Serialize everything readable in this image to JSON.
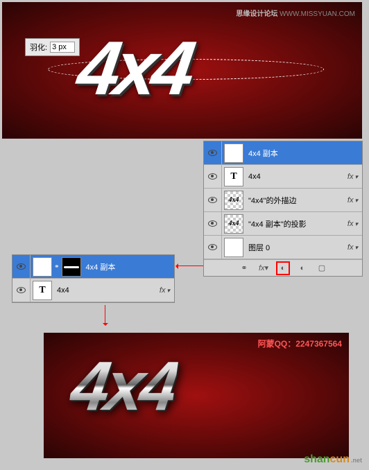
{
  "attribution": {
    "label": "思缘设计论坛",
    "url": "WWW.MISSYUAN.COM"
  },
  "feather": {
    "label": "羽化:",
    "value": "3 px"
  },
  "text4x4": "4x4",
  "rightPanel": {
    "layers": [
      {
        "name": "4x4 副本",
        "selected": true,
        "thumbType": "T"
      },
      {
        "name": "4x4",
        "thumbType": "T",
        "fx": "fx"
      },
      {
        "name": "\"4x4\"的外描边",
        "thumbType": "checker",
        "fx": "fx"
      },
      {
        "name": "\"4x4 副本\"的投影",
        "thumbType": "checker",
        "fx": "fx"
      },
      {
        "name": "图层 0",
        "thumbType": "white",
        "fx": "fx"
      }
    ],
    "footer": {
      "link": "⚭",
      "fx": "fx",
      "mask": "◐",
      "adj": "◐",
      "folder": "▢"
    }
  },
  "leftPanel": {
    "layers": [
      {
        "name": "4x4 副本",
        "selected": true,
        "thumbType": "T",
        "mask": true
      },
      {
        "name": "4x4",
        "thumbType": "T",
        "fx": "fx"
      }
    ]
  },
  "bottomCredit": "阿蒙QQ：2247367564",
  "watermark": {
    "part1": "shan",
    "part2": "cun",
    "sub": ".net"
  }
}
